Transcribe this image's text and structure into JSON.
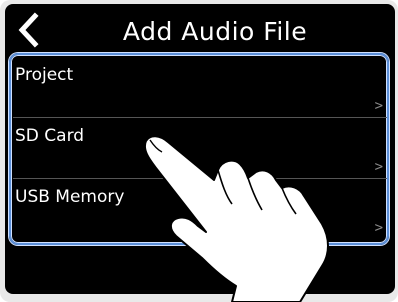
{
  "header": {
    "title": "Add Audio File",
    "back_icon": "chevron-left-icon"
  },
  "list": {
    "items": [
      {
        "label": "Project",
        "chevron": ">"
      },
      {
        "label": "SD Card",
        "chevron": ">"
      },
      {
        "label": "USB Memory",
        "chevron": ">"
      }
    ]
  },
  "colors": {
    "screen_bg": "#000000",
    "text": "#ffffff",
    "selection_frame": "#5b8fd8",
    "chevron": "#8a8a8a"
  }
}
